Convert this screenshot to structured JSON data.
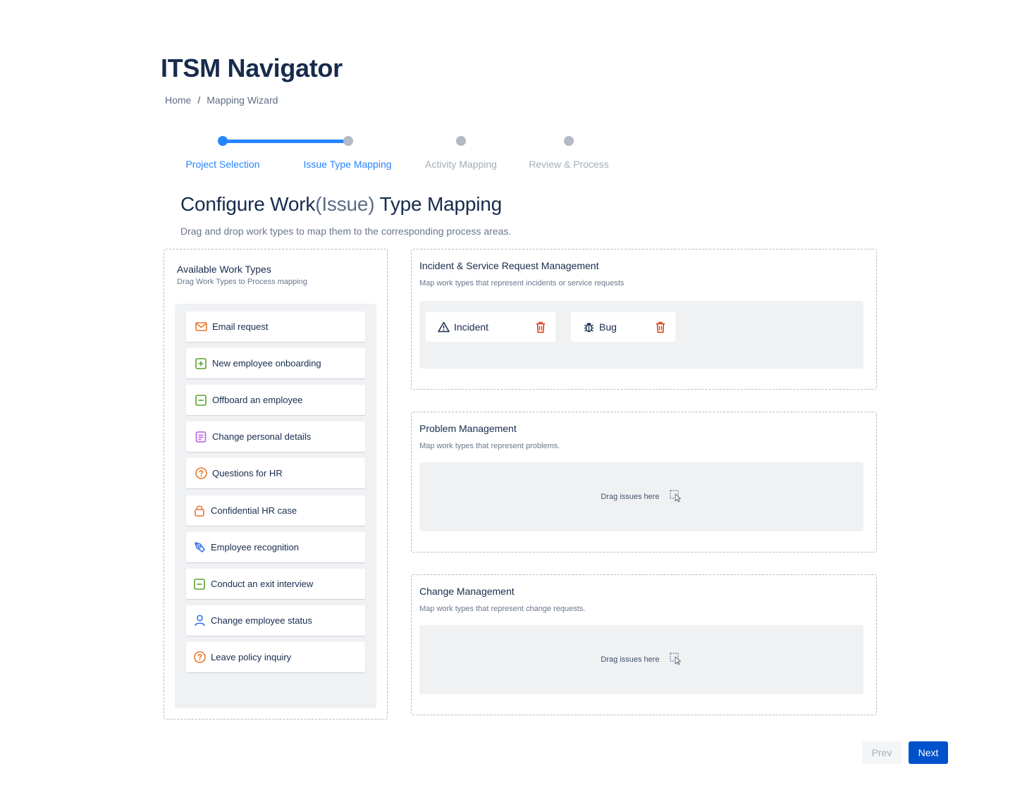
{
  "app": {
    "title": "ITSM Navigator"
  },
  "breadcrumb": {
    "items": [
      "Home",
      "Mapping Wizard"
    ],
    "separator": "/"
  },
  "stepper": {
    "steps": [
      {
        "label": "Project Selection",
        "state": "done"
      },
      {
        "label": "Issue Type Mapping",
        "state": "current"
      },
      {
        "label": "Activity Mapping",
        "state": "todo"
      },
      {
        "label": "Review & Process",
        "state": "todo"
      }
    ],
    "active_color": "#2684ff",
    "inactive_color": "#b3bac5"
  },
  "section": {
    "title_pre": "Configure Work",
    "title_paren": "(Issue)",
    "title_post": " Type Mapping",
    "subtitle": "Drag and drop work types to map them to the corresponding process areas."
  },
  "available": {
    "title": "Available Work Types",
    "hint": "Drag Work Types to Process mapping",
    "items": [
      {
        "label": "Email request",
        "icon": "envelope-icon",
        "color": "#e9772e"
      },
      {
        "label": "New employee onboarding",
        "icon": "plus-square-icon",
        "color": "#5aa02c"
      },
      {
        "label": "Offboard an employee",
        "icon": "minus-square-icon",
        "color": "#5aa02c"
      },
      {
        "label": "Change personal details",
        "icon": "document-icon",
        "color": "#b65ce8"
      },
      {
        "label": "Questions for HR",
        "icon": "question-circle-icon",
        "color": "#e9772e"
      },
      {
        "label": "Confidential HR case",
        "icon": "lock-icon",
        "color": "#e9772e"
      },
      {
        "label": "Employee recognition",
        "icon": "award-icon",
        "color": "#2f6fe4"
      },
      {
        "label": "Conduct an exit interview",
        "icon": "minus-square-icon",
        "color": "#5aa02c"
      },
      {
        "label": "Change employee status",
        "icon": "person-icon",
        "color": "#2f6fe4"
      },
      {
        "label": "Leave policy inquiry",
        "icon": "question-circle-icon",
        "color": "#e9772e"
      }
    ]
  },
  "processes": [
    {
      "title": "Incident & Service Request Management",
      "hint": "Map work types that represent incidents or service requests",
      "mapped": [
        {
          "label": "Incident",
          "icon": "warning-triangle-icon"
        },
        {
          "label": "Bug",
          "icon": "bug-icon"
        }
      ]
    },
    {
      "title": "Problem Management",
      "hint": "Map work types that represent problems.",
      "empty_text": "Drag issues here"
    },
    {
      "title": "Change Management",
      "hint": "Map work types that represent change requests.",
      "empty_text": "Drag issues here"
    }
  ],
  "delete_color": "#de350b",
  "nav": {
    "prev": "Prev",
    "next": "Next"
  }
}
